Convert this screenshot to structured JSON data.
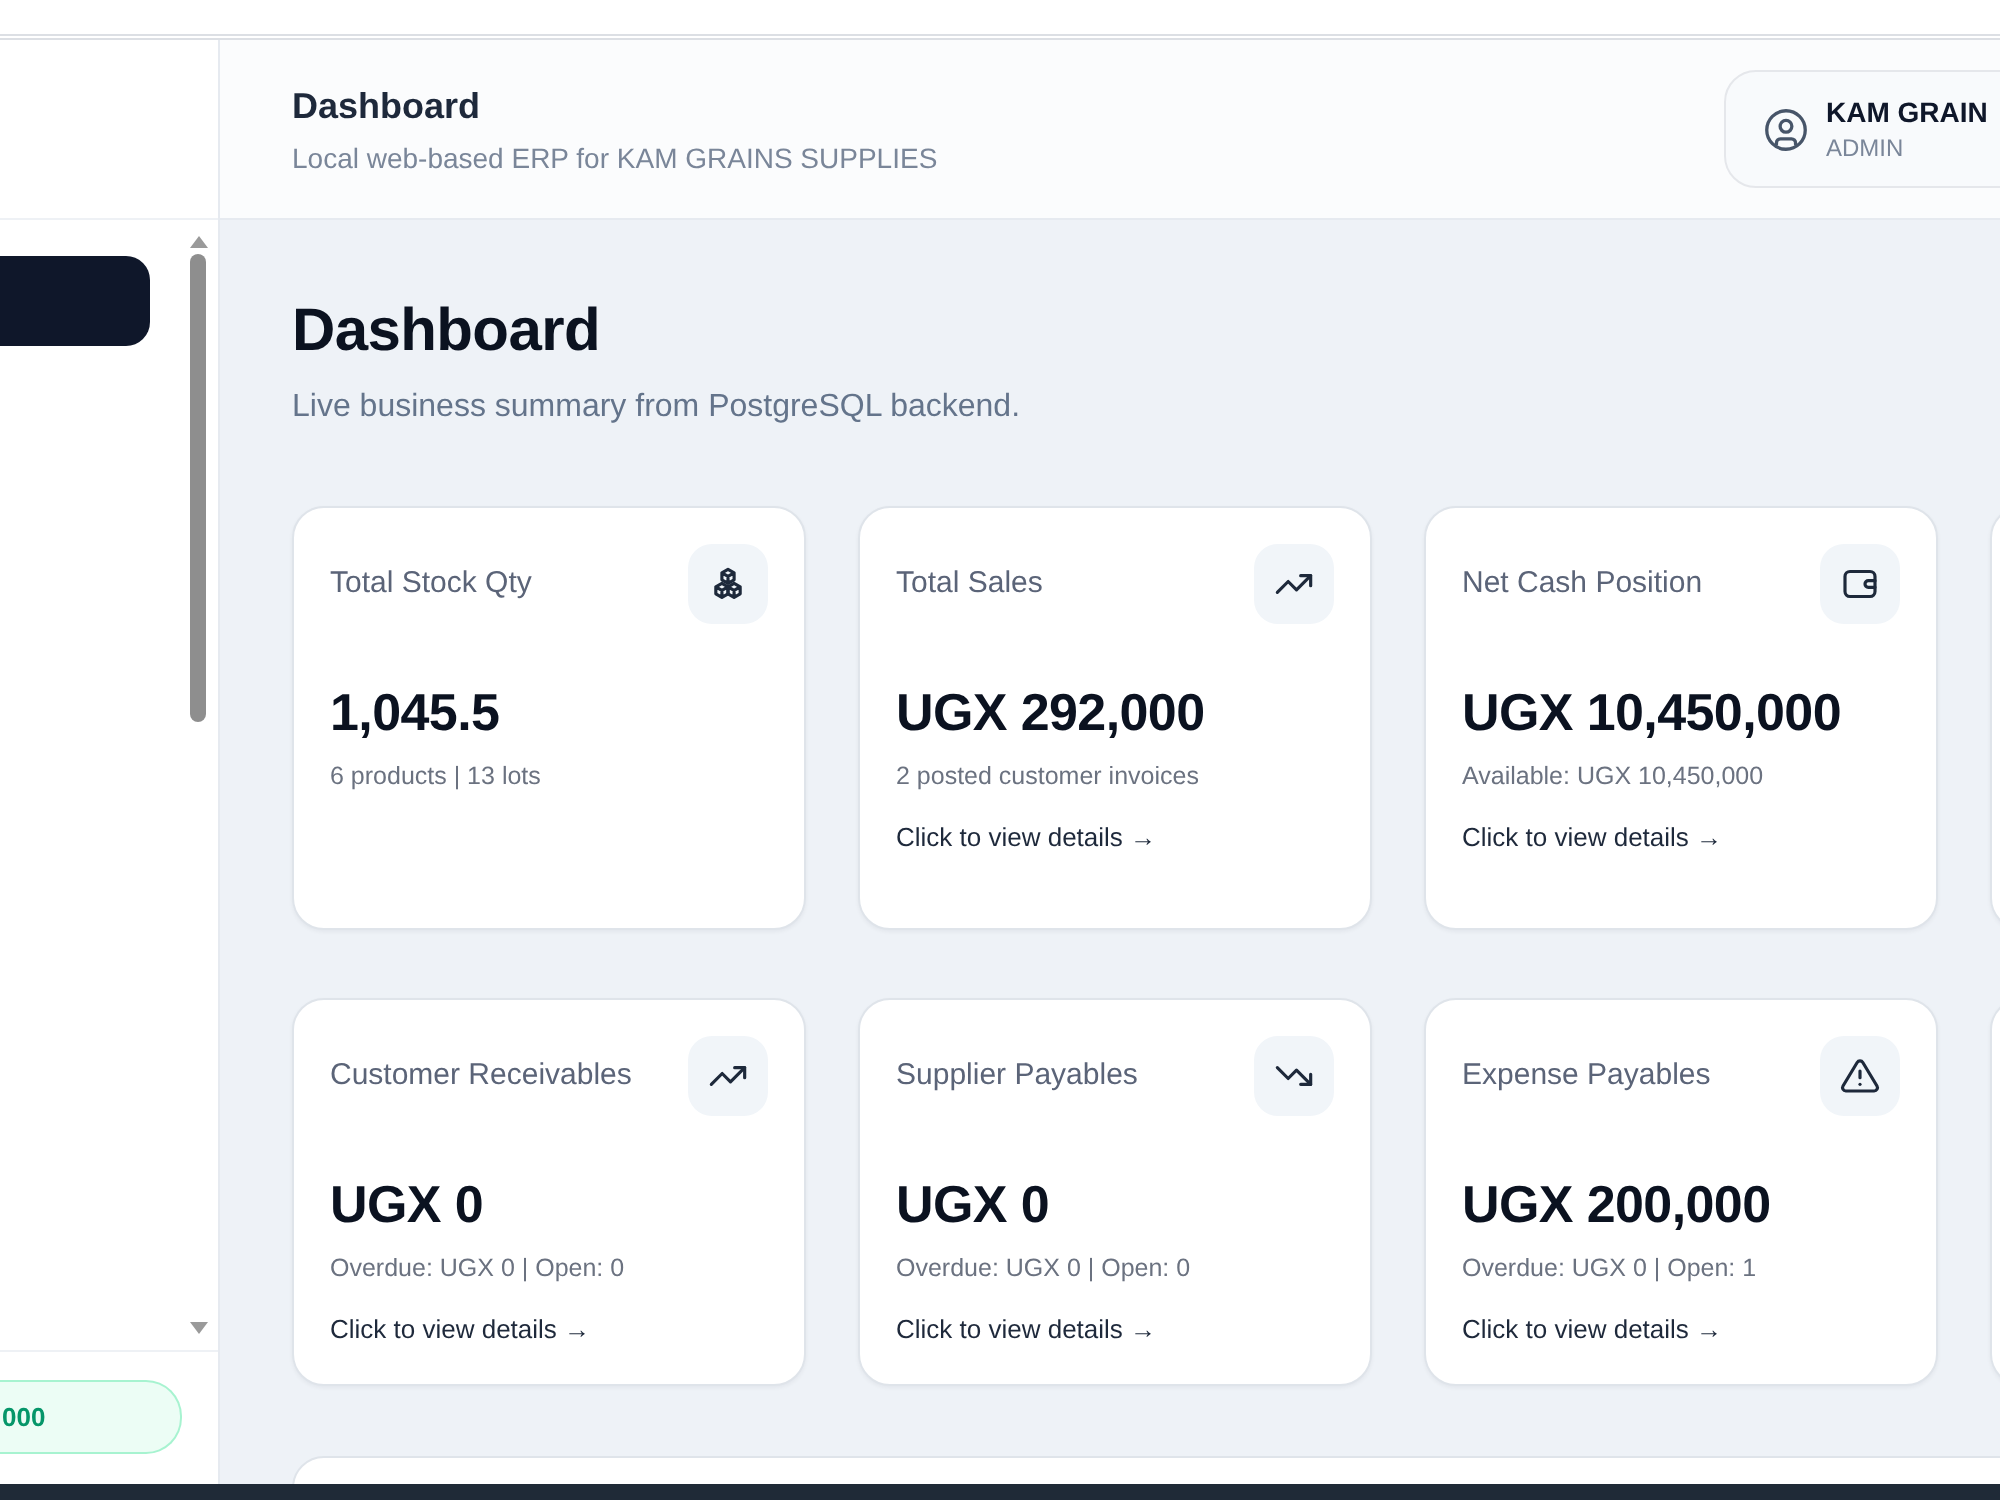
{
  "header": {
    "title": "Dashboard",
    "subtitle": "Local web-based ERP for KAM GRAINS SUPPLIES",
    "user": {
      "name": "KAM GRAIN",
      "role": "ADMIN"
    }
  },
  "sidebar": {
    "items": [
      {
        "selected": true
      }
    ],
    "footer_badge": "000"
  },
  "page": {
    "title": "Dashboard",
    "subtitle": "Live business summary from PostgreSQL backend."
  },
  "card_rows": [
    {
      "cards": [
        {
          "kind": "stock",
          "title": "Total Stock Qty",
          "value": "1,045.5",
          "detail": "6 products | 13 lots"
        },
        {
          "kind": "sales",
          "title": "Total Sales",
          "value": "UGX 292,000",
          "detail": "2 posted customer invoices",
          "link": "Click to view details →"
        },
        {
          "kind": "cash",
          "title": "Net Cash Position",
          "value": "UGX 10,450,000",
          "detail": "Available: UGX 10,450,000",
          "link": "Click to view details →"
        }
      ]
    },
    {
      "cards": [
        {
          "kind": "receivable",
          "title": "Customer Receivables",
          "value": "UGX 0",
          "detail": "Overdue: UGX 0 | Open: 0",
          "link": "Click to view details →"
        },
        {
          "kind": "payable",
          "title": "Supplier Payables",
          "value": "UGX 0",
          "detail": "Overdue: UGX 0 | Open: 0",
          "link": "Click to view details →"
        },
        {
          "kind": "expense",
          "title": "Expense Payables",
          "value": "UGX 200,000",
          "detail": "Overdue: UGX 0 | Open: 1",
          "link": "Click to view details →"
        }
      ]
    }
  ]
}
